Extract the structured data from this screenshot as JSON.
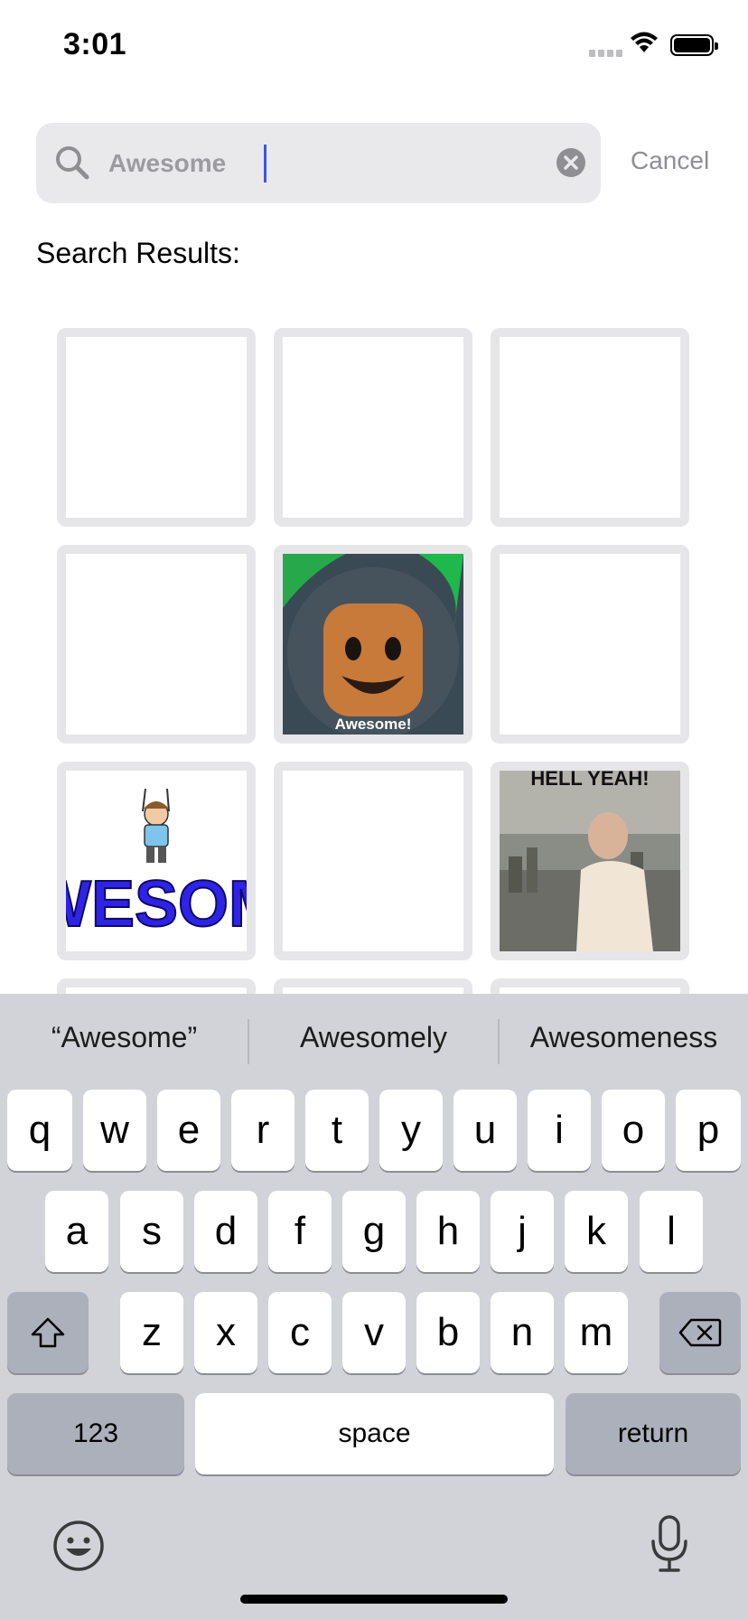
{
  "status": {
    "time": "3:01"
  },
  "search": {
    "value": "Awesome",
    "cancel_label": "Cancel"
  },
  "results": {
    "label": "Search Results:",
    "tiles": [
      {
        "content": "blank"
      },
      {
        "content": "blank"
      },
      {
        "content": "blank"
      },
      {
        "content": "blank"
      },
      {
        "content": "lego-figure-gif",
        "caption": "Awesome!"
      },
      {
        "content": "blank"
      },
      {
        "content": "awesome-wordart-gif",
        "text": "WESOM"
      },
      {
        "content": "blank"
      },
      {
        "content": "hell-yeah-gif",
        "caption": "HELL YEAH!"
      }
    ]
  },
  "keyboard": {
    "suggestions": [
      "“Awesome”",
      "Awesomely",
      "Awesomeness"
    ],
    "row1": [
      "q",
      "w",
      "e",
      "r",
      "t",
      "y",
      "u",
      "i",
      "o",
      "p"
    ],
    "row2": [
      "a",
      "s",
      "d",
      "f",
      "g",
      "h",
      "j",
      "k",
      "l"
    ],
    "row3": [
      "z",
      "x",
      "c",
      "v",
      "b",
      "n",
      "m"
    ],
    "numbers_label": "123",
    "space_label": "space",
    "return_label": "return"
  }
}
